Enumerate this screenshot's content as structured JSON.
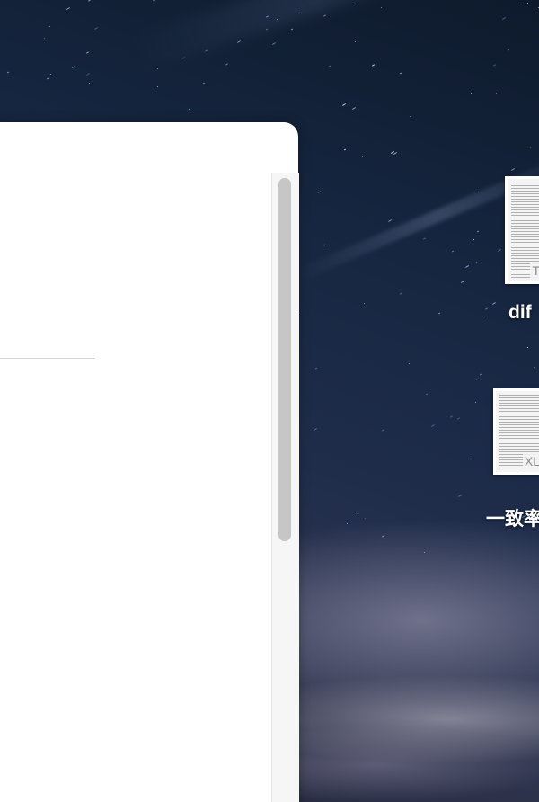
{
  "desktop": {
    "wallpaper": "starry-night-sky",
    "icons": [
      {
        "label": "dif",
        "type_badge": "T",
        "icon": "text-file-icon"
      },
      {
        "label": "一致率",
        "type_badge": "XL",
        "icon": "spreadsheet-file-icon"
      }
    ]
  },
  "window": {
    "background": "#ffffff",
    "scrollbar_thumb_color": "#c6c6c6"
  }
}
